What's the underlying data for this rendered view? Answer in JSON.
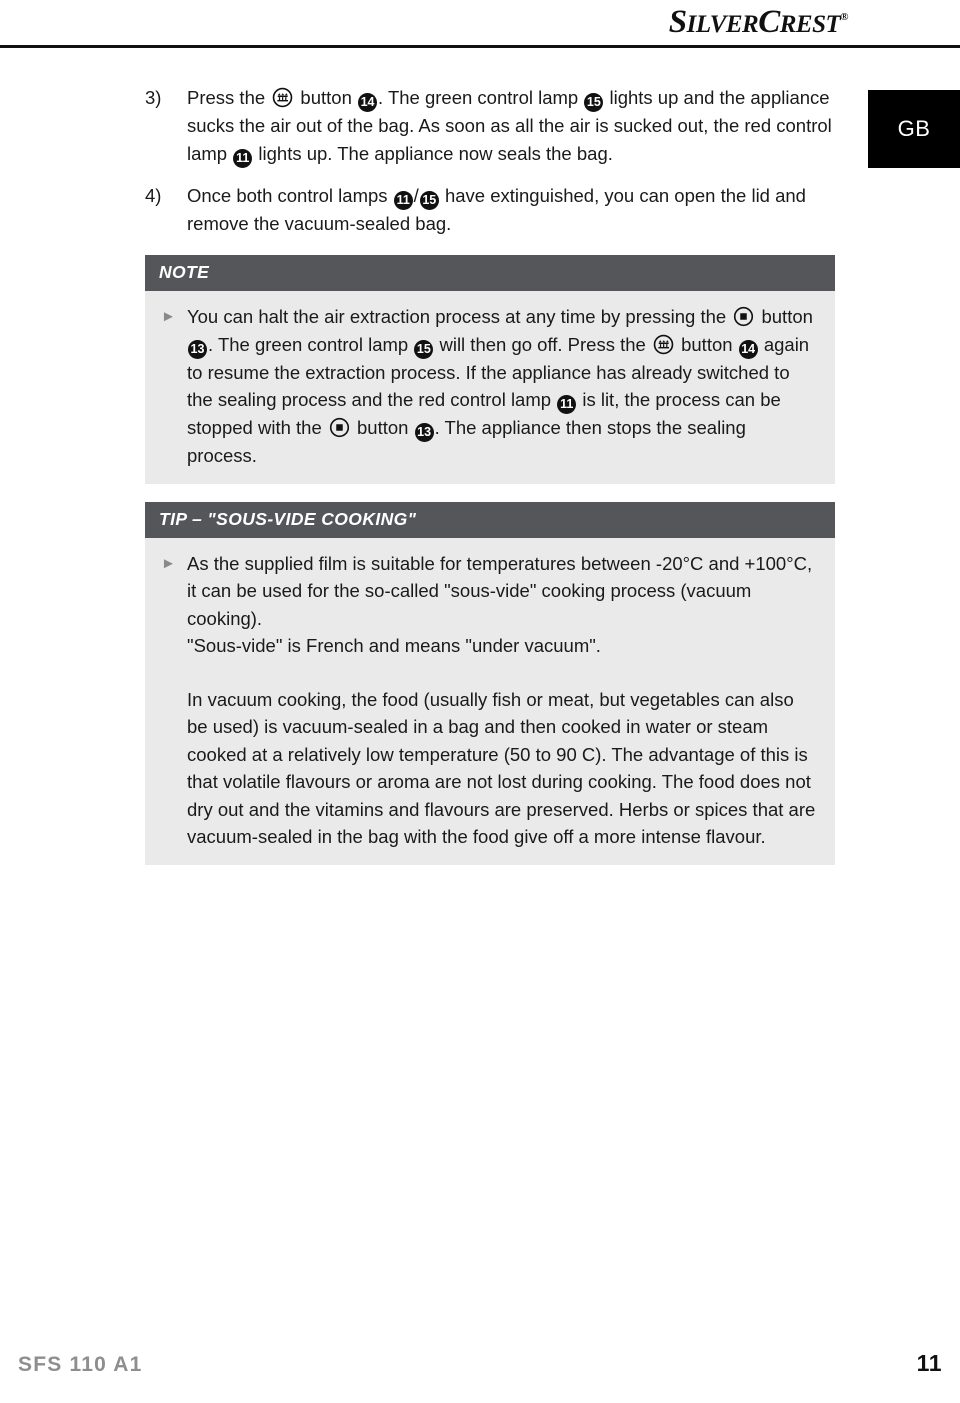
{
  "header": {
    "brand_part1": "Silver",
    "brand_part2": "Crest",
    "brand_registered": "®"
  },
  "country_badge": {
    "label": "GB"
  },
  "icons": {
    "vacuum_button": "vacuum-button-icon",
    "stop_button": "stop-button-icon",
    "bullet_arrow": "►"
  },
  "steps": [
    {
      "number": "3)",
      "segments": [
        {
          "type": "text",
          "value": "Press the "
        },
        {
          "type": "icon",
          "value": "vacuum"
        },
        {
          "type": "text",
          "value": " button "
        },
        {
          "type": "circlenum",
          "value": "14"
        },
        {
          "type": "text",
          "value": ". The green control lamp "
        },
        {
          "type": "circlenum",
          "value": "15"
        },
        {
          "type": "text",
          "value": " lights up and the appliance sucks the air out of the bag. As soon as all the air is sucked out, the red control lamp "
        },
        {
          "type": "circlenum",
          "value": "11"
        },
        {
          "type": "text",
          "value": " lights up. The appliance now seals the bag."
        }
      ]
    },
    {
      "number": "4)",
      "segments": [
        {
          "type": "text",
          "value": "Once both control lamps "
        },
        {
          "type": "circlenum",
          "value": "11"
        },
        {
          "type": "text",
          "value": "/"
        },
        {
          "type": "circlenum",
          "value": "15"
        },
        {
          "type": "text",
          "value": " have extinguished, you can open the lid and remove the vacuum-sealed bag."
        }
      ]
    }
  ],
  "note": {
    "title": "NOTE",
    "bullet": [
      {
        "type": "text",
        "value": "You can halt the air extraction process at any time by pressing the "
      },
      {
        "type": "icon",
        "value": "stop"
      },
      {
        "type": "text",
        "value": " button "
      },
      {
        "type": "circlenum",
        "value": "13"
      },
      {
        "type": "text",
        "value": ". The green control lamp "
      },
      {
        "type": "circlenum",
        "value": "15"
      },
      {
        "type": "text",
        "value": " will then go off. Press the "
      },
      {
        "type": "icon",
        "value": "vacuum"
      },
      {
        "type": "text",
        "value": " button "
      },
      {
        "type": "circlenum",
        "value": "14"
      },
      {
        "type": "text",
        "value": " again to resume the extraction process. If the appliance has already switched to the sealing process and the red control lamp "
      },
      {
        "type": "circlenum",
        "value": "11"
      },
      {
        "type": "text",
        "value": " is lit, the process can be stopped with the "
      },
      {
        "type": "icon",
        "value": "stop"
      },
      {
        "type": "text",
        "value": " button "
      },
      {
        "type": "circlenum",
        "value": "13"
      },
      {
        "type": "text",
        "value": ". The appliance then stops the sealing process."
      }
    ]
  },
  "tip": {
    "title": "TIP – \"SOUS-VIDE COOKING\"",
    "bullet_text": "As the supplied film is suitable for temperatures between -20°C and +100°C, it can be used for the so-called \"sous-vide\" cooking process (vacuum cooking).\n\"Sous-vide\" is French and means \"under vacuum\".",
    "paragraph": "In vacuum cooking, the food (usually fish or meat, but vegetables can also be used) is vacuum-sealed in a bag and then cooked in water or steam cooked at a relatively low temperature (50 to 90 C). The advantage of this is that volatile flavours or aroma are not lost during cooking. The food does not dry out and the vitamins and flavours are preserved. Herbs or spices that are vacuum-sealed in the bag with the food give off a more intense flavour."
  },
  "footer": {
    "model": "SFS 110 A1",
    "page_number": "11"
  },
  "colors": {
    "callout_header_bg": "#55565a",
    "callout_body_bg": "#eaeaea",
    "badge_bg": "#000000",
    "footer_model": "#8e8e8e",
    "rule": "#111111"
  }
}
